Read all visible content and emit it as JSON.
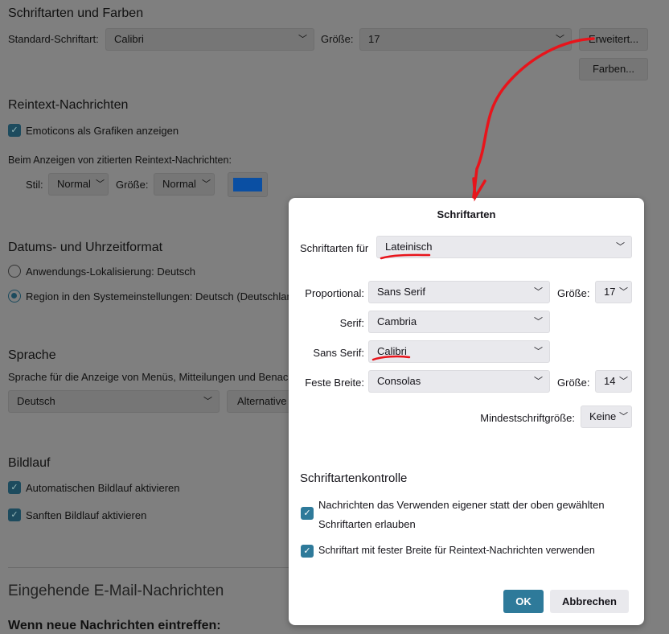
{
  "fonts_colors": {
    "title": "Schriftarten und Farben",
    "default_font_label": "Standard-Schriftart:",
    "default_font_value": "Calibri",
    "size_label": "Größe:",
    "size_value": "17",
    "advanced_button": "Erweitert...",
    "colors_button": "Farben..."
  },
  "plaintext": {
    "title": "Reintext-Nachrichten",
    "emoticons_label": "Emoticons als Grafiken anzeigen",
    "emoticons_checked": true,
    "quoted_label": "Beim Anzeigen von zitierten Reintext-Nachrichten:",
    "style_label": "Stil:",
    "style_value": "Normal",
    "size_label": "Größe:",
    "size_value": "Normal",
    "quote_color": "#0a4fa3"
  },
  "datetime": {
    "title": "Datums- und Uhrzeitformat",
    "option_app": "Anwendungs-Lokalisierung: Deutsch",
    "option_region": "Region in den Systemeinstellungen: Deutsch (Deutschlan",
    "selected": "region"
  },
  "language": {
    "title": "Sprache",
    "description": "Sprache für die Anzeige von Menüs, Mitteilungen und Benac",
    "value": "Deutsch",
    "alternative_button": "Alternative"
  },
  "scrolling": {
    "title": "Bildlauf",
    "autoscroll_label": "Automatischen Bildlauf aktivieren",
    "smooth_label": "Sanften Bildlauf aktivieren"
  },
  "incoming": {
    "title": "Eingehende E-Mail-Nachrichten",
    "subtitle": "Wenn neue Nachrichten eintreffen:"
  },
  "dialog": {
    "title": "Schriftarten",
    "fonts_for_label": "Schriftarten für",
    "fonts_for_value": "Lateinisch",
    "proportional_label": "Proportional:",
    "proportional_value": "Sans Serif",
    "prop_size_label": "Größe:",
    "prop_size_value": "17",
    "serif_label": "Serif:",
    "serif_value": "Cambria",
    "sans_label": "Sans Serif:",
    "sans_value": "Calibri",
    "mono_label": "Feste Breite:",
    "mono_value": "Consolas",
    "mono_size_label": "Größe:",
    "mono_size_value": "14",
    "min_size_label": "Mindestschriftgröße:",
    "min_size_value": "Keine",
    "control_title": "Schriftartenkontrolle",
    "allow_fonts_line1": "Nachrichten das Verwenden eigener statt der oben gewählten",
    "allow_fonts_line2": "Schriftarten erlauben",
    "mono_plain_label": "Schriftart mit fester Breite für Reintext-Nachrichten verwenden",
    "ok_button": "OK",
    "cancel_button": "Abbrechen"
  },
  "colors": {
    "accent": "#2e7a9a",
    "annotation": "#e8141b"
  }
}
